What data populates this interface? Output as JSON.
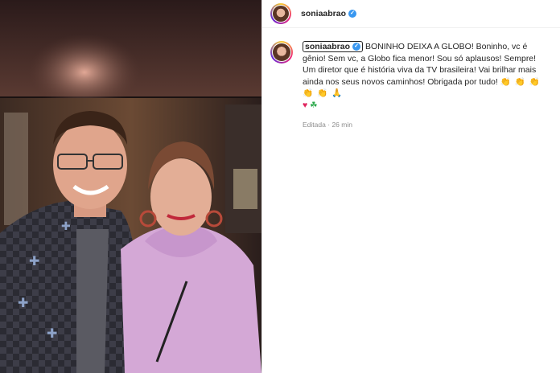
{
  "post": {
    "username": "soniaabrao",
    "verified_glyph": "✓",
    "caption_text": "BONINHO DEIXA A GLOBO! Boninho, vc é gênio! Sem vc, a Globo fica menor! Sou só aplausos! Sempre! Um diretor que é história viva da TV brasileira! Vai brilhar mais ainda nos seus novos caminhos! Obrigada por tudo!",
    "caption_emojis": "👏 👏 👏 👏 👏 🙏",
    "caption_heart": "♥",
    "caption_clover": "☘",
    "edited_label": "Editada",
    "separator": "·",
    "time_ago": "26 min"
  },
  "colors": {
    "verified": "#3897f0",
    "text": "#262626",
    "muted": "#8e8e8e"
  },
  "icons": {
    "verified": "verified-badge-icon",
    "avatar": "profile-avatar"
  }
}
